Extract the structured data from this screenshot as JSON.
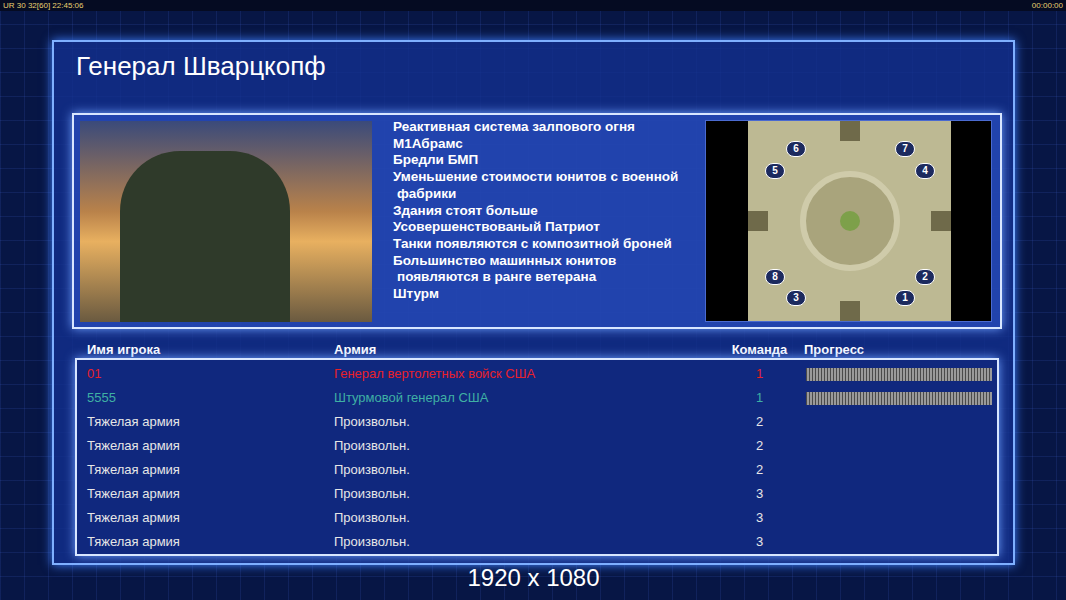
{
  "status_bar": {
    "left": "UR 30 32[60] 22:45:06",
    "right": "00:00:00"
  },
  "title": "Генерал Шварцкопф",
  "features": [
    {
      "lines": [
        "Реактивная система залпового огня"
      ]
    },
    {
      "lines": [
        "М1Абрамс"
      ]
    },
    {
      "lines": [
        "Бредли БМП"
      ]
    },
    {
      "lines": [
        "Уменьшение стоимости юнитов с военной",
        "фабрики"
      ]
    },
    {
      "lines": [
        "Здания стоят больше"
      ]
    },
    {
      "lines": [
        "Усовершенствованый Патриот"
      ]
    },
    {
      "lines": [
        "Танки появляются с композитной броней"
      ]
    },
    {
      "lines": [
        "Большинство машинных юнитов",
        "появляются в ранге ветерана"
      ]
    },
    {
      "lines": [
        "Штурм"
      ]
    }
  ],
  "map": {
    "slots": [
      "6",
      "7",
      "5",
      "4",
      "8",
      "2",
      "3",
      "1"
    ]
  },
  "table": {
    "columns": [
      "Имя игрока",
      "Армия",
      "Команда",
      "Прогресс"
    ],
    "rows": [
      {
        "name": "01",
        "army": "Генерал вертолетных войск США",
        "team": "1",
        "color": "#e8202a",
        "kind": "player",
        "level": 1
      },
      {
        "name": "5555",
        "army": "Штурмовой генерал США",
        "team": "1",
        "color": "#3fb0a4",
        "kind": "player",
        "level": 1
      },
      {
        "name": "Тяжелая армия",
        "army": "Произвольн.",
        "team": "2",
        "color": "#e6e6e6",
        "kind": "computer",
        "level": 0
      },
      {
        "name": "Тяжелая армия",
        "army": "Произвольн.",
        "team": "2",
        "color": "#e6e6e6",
        "kind": "computer",
        "level": 0
      },
      {
        "name": "Тяжелая армия",
        "army": "Произвольн.",
        "team": "2",
        "color": "#e6e6e6",
        "kind": "computer",
        "level": 0
      },
      {
        "name": "Тяжелая армия",
        "army": "Произвольн.",
        "team": "3",
        "color": "#e6e6e6",
        "kind": "computer",
        "level": 0
      },
      {
        "name": "Тяжелая армия",
        "army": "Произвольн.",
        "team": "3",
        "color": "#e6e6e6",
        "kind": "computer",
        "level": 0
      },
      {
        "name": "Тяжелая армия",
        "army": "Произвольн.",
        "team": "3",
        "color": "#e6e6e6",
        "kind": "computer",
        "level": 0
      }
    ]
  },
  "resolution": "1920 x 1080"
}
